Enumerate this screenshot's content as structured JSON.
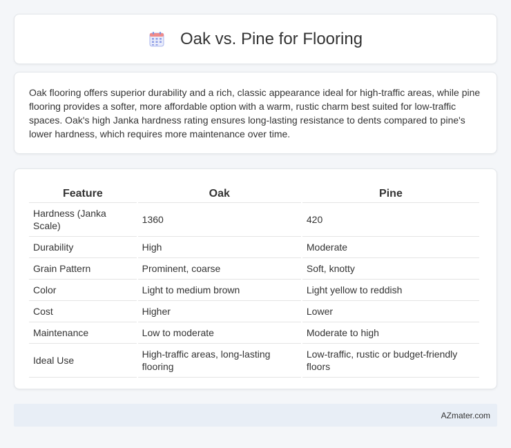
{
  "header": {
    "icon": "calendar-icon",
    "title": "Oak vs. Pine for Flooring"
  },
  "summary": {
    "text": "Oak flooring offers superior durability and a rich, classic appearance ideal for high-traffic areas, while pine flooring provides a softer, more affordable option with a warm, rustic charm best suited for low-traffic spaces. Oak's high Janka hardness rating ensures long-lasting resistance to dents compared to pine's lower hardness, which requires more maintenance over time."
  },
  "table": {
    "headers": [
      "Feature",
      "Oak",
      "Pine"
    ],
    "rows": [
      [
        "Hardness (Janka Scale)",
        "1360",
        "420"
      ],
      [
        "Durability",
        "High",
        "Moderate"
      ],
      [
        "Grain Pattern",
        "Prominent, coarse",
        "Soft, knotty"
      ],
      [
        "Color",
        "Light to medium brown",
        "Light yellow to reddish"
      ],
      [
        "Cost",
        "Higher",
        "Lower"
      ],
      [
        "Maintenance",
        "Low to moderate",
        "Moderate to high"
      ],
      [
        "Ideal Use",
        "High-traffic areas, long-lasting flooring",
        "Low-traffic, rustic or budget-friendly floors"
      ]
    ]
  },
  "footer": {
    "site": "AZmater.com"
  },
  "colors": {
    "background": "#f4f6f9",
    "footer_bg": "#e8eef6",
    "icon_accent": "#7b8fe0"
  }
}
